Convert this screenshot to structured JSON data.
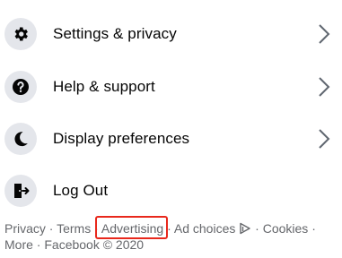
{
  "menu": {
    "items": [
      {
        "label": "Settings & privacy",
        "icon": "gear-icon"
      },
      {
        "label": "Help & support",
        "icon": "question-icon"
      },
      {
        "label": "Display preferences",
        "icon": "moon-icon"
      },
      {
        "label": "Log Out",
        "icon": "logout-icon"
      }
    ]
  },
  "footer": {
    "links": [
      "Privacy",
      "Terms",
      "Advertising",
      "Ad choices",
      "Cookies",
      "More"
    ],
    "separator": "·",
    "copyright": "Facebook © 2020"
  },
  "highlight": {
    "target": "Advertising",
    "color": "#e8281c"
  },
  "colors": {
    "icon_bg": "#e4e6eb",
    "text": "#050505",
    "secondary": "#65676b"
  }
}
